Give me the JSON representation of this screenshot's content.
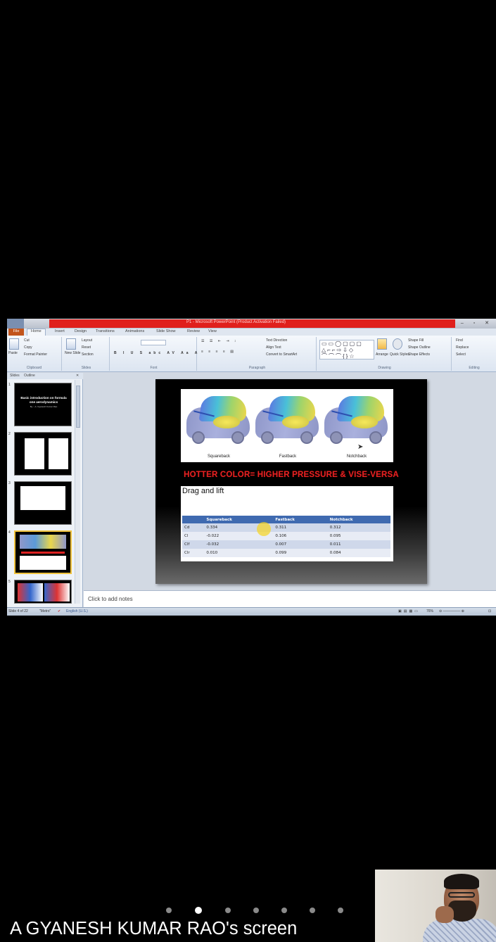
{
  "powerpoint": {
    "title_bar": "P1 - Microsoft PowerPoint (Product Activation Failed)",
    "tabs": [
      "File",
      "Home",
      "Insert",
      "Design",
      "Transitions",
      "Animations",
      "Slide Show",
      "Review",
      "View"
    ],
    "ribbon": {
      "clipboard": {
        "paste": "Paste",
        "cut": "Cut",
        "copy": "Copy",
        "format_painter": "Format Painter",
        "name": "Clipboard"
      },
      "slides": {
        "new_slide": "New Slide",
        "layout": "Layout",
        "reset": "Reset",
        "section": "Section",
        "name": "Slides"
      },
      "font": {
        "name": "Font"
      },
      "paragraph": {
        "text_direction": "Text Direction",
        "align_text": "Align Text",
        "convert_smartart": "Convert to SmartArt",
        "name": "Paragraph"
      },
      "drawing": {
        "arrange": "Arrange",
        "quick_styles": "Quick Styles",
        "shape_fill": "Shape Fill",
        "shape_outline": "Shape Outline",
        "shape_effects": "Shape Effects",
        "name": "Drawing"
      },
      "editing": {
        "find": "Find",
        "replace": "Replace",
        "select": "Select",
        "name": "Editing"
      }
    },
    "pane_tabs": [
      "Slides",
      "Outline"
    ],
    "thumbnails": [
      {
        "num": "1",
        "title": "Basic introduction on formula one aerodynamics",
        "subtitle": "By :- A. Gyanesh Kumar Rao"
      },
      {
        "num": "2"
      },
      {
        "num": "3"
      },
      {
        "num": "4"
      },
      {
        "num": "5"
      }
    ],
    "slide": {
      "car_labels": [
        "Squareback",
        "Fastback",
        "Notchback"
      ],
      "banner": "HOTTER COLOR= HIGHER PRESSURE & VISE-VERSA",
      "table_title": "Drag and lift",
      "table": {
        "headers": [
          "",
          "Squareback",
          "Fastback",
          "Notchback"
        ],
        "rows": [
          [
            "Cd",
            "0.334",
            "0.311",
            "0.312"
          ],
          [
            "Cl",
            "-0.022",
            "0.106",
            "0.095"
          ],
          [
            "Clf",
            "-0.032",
            "0.007",
            "0.011"
          ],
          [
            "Clr",
            "0.010",
            "0.099",
            "0.084"
          ]
        ]
      }
    },
    "notes_placeholder": "Click to add notes",
    "status": {
      "slide_count": "Slide 4 of 22",
      "theme": "\"Metro\"",
      "language": "English (U.S.)",
      "zoom": "76%"
    }
  },
  "meeting": {
    "sharer_label": "A GYANESH KUMAR RAO's screen",
    "page_dots": 8,
    "active_dot": 2
  }
}
